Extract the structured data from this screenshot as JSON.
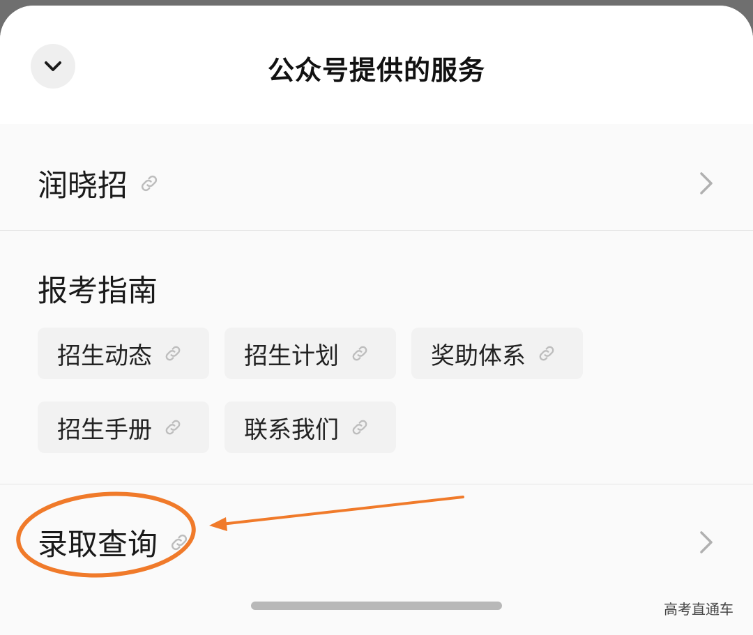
{
  "header": {
    "title": "公众号提供的服务",
    "collapse_icon": "chevron-down-icon"
  },
  "items": [
    {
      "label": "润晓招",
      "link_icon": "link-icon",
      "chevron": "chevron-right-icon"
    }
  ],
  "guide": {
    "title": "报考指南",
    "chips": [
      {
        "label": "招生动态"
      },
      {
        "label": "招生计划"
      },
      {
        "label": "奖助体系"
      },
      {
        "label": "招生手册"
      },
      {
        "label": "联系我们"
      }
    ]
  },
  "query": {
    "label": "录取查询",
    "link_icon": "link-icon",
    "chevron": "chevron-right-icon"
  },
  "watermark": "高考直通车",
  "colors": {
    "annotation": "#f07a2a",
    "link_icon": "#bdbdbd",
    "chevron": "#b0b0b0"
  }
}
